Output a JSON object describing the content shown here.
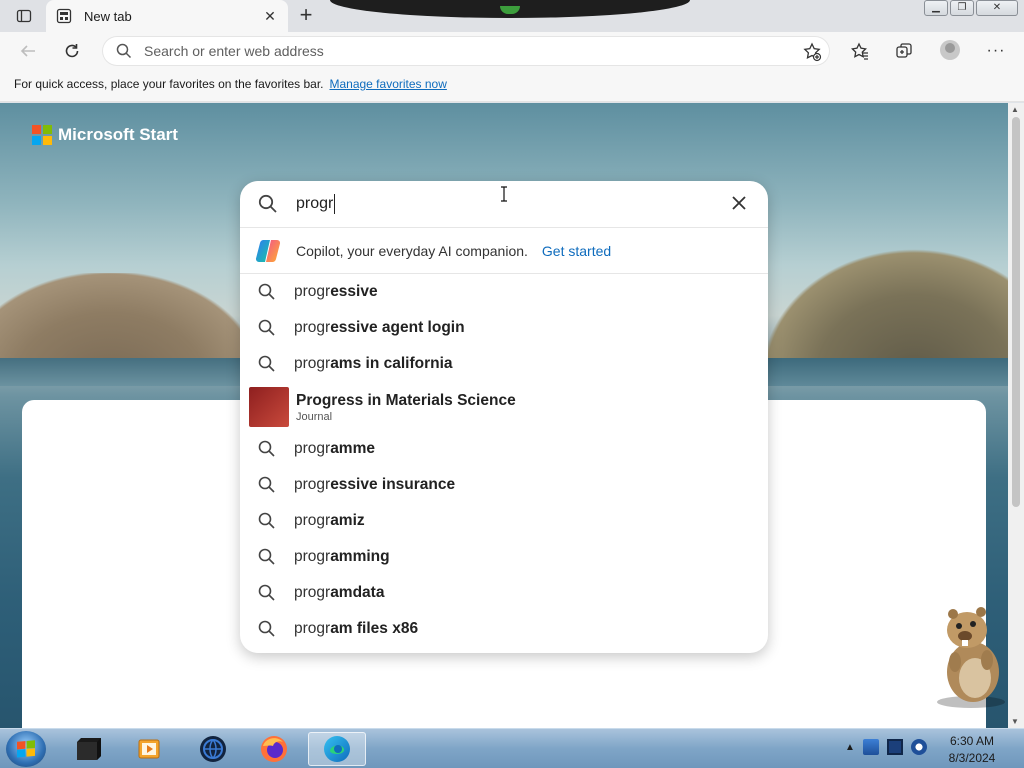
{
  "browser": {
    "tab": {
      "title": "New tab",
      "close_icon": "close-icon"
    },
    "address_placeholder": "Search or enter web address",
    "favorites_bar": {
      "message": "For quick access, place your favorites on the favorites bar.",
      "link": "Manage favorites now"
    }
  },
  "page": {
    "brand": "Microsoft Start",
    "search": {
      "query": "progr",
      "copilot": {
        "text": "Copilot, your everyday AI companion.",
        "link": "Get started"
      },
      "suggestions": [
        {
          "prefix": "progr",
          "rest": "essive"
        },
        {
          "prefix": "progr",
          "rest": "essive agent login"
        },
        {
          "prefix": "progr",
          "rest": "ams in california"
        },
        {
          "entity": true,
          "title": "Progress in Materials Science",
          "subtitle": "Journal"
        },
        {
          "prefix": "progr",
          "rest": "amme"
        },
        {
          "prefix": "progr",
          "rest": "essive insurance"
        },
        {
          "prefix": "progr",
          "rest": "amiz"
        },
        {
          "prefix": "progr",
          "rest": "amming"
        },
        {
          "prefix": "progr",
          "rest": "amdata"
        },
        {
          "prefix": "progr",
          "rest": "am files x86"
        }
      ]
    }
  },
  "taskbar": {
    "clock": {
      "time": "6:30 AM",
      "date": "8/3/2024"
    },
    "apps": [
      "terminal-icon",
      "media-player-icon",
      "globe-icon",
      "firefox-icon",
      "edge-icon"
    ]
  },
  "colors": {
    "accent": "#0f6cbd",
    "logo": [
      "#f35325",
      "#81bc06",
      "#05a6f0",
      "#ffba08"
    ]
  }
}
